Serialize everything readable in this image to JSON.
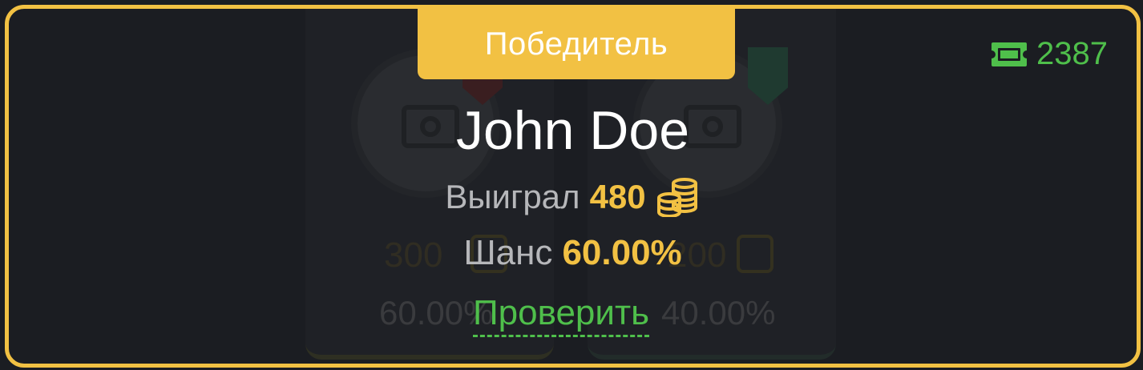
{
  "winner_tab": {
    "label": "Победитель"
  },
  "tickets": {
    "count": "2387",
    "icon": "ticket-icon",
    "color": "#4fbf4b"
  },
  "winner": {
    "name": "John Doe",
    "won_label": "Выиграл",
    "won_value": "480",
    "chance_label": "Шанс",
    "chance_value": "60.00%",
    "check_link": "Проверить"
  },
  "background_players": [
    {
      "amount": "300",
      "chance": "60.00%",
      "badge_color": "#3a1e20"
    },
    {
      "amount": "200",
      "chance": "40.00%",
      "badge_color": "#1f3a30"
    }
  ],
  "colors": {
    "accent": "#f2c143",
    "success": "#4fbf4b",
    "background": "#1b1d22"
  }
}
